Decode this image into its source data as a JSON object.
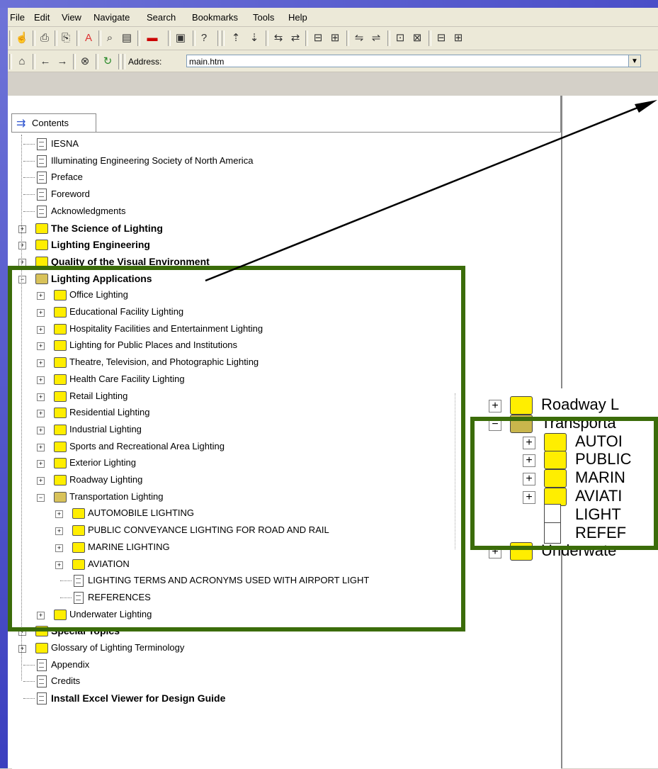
{
  "menu": [
    "File",
    "Edit",
    "View",
    "Navigate",
    "Search",
    "Bookmarks",
    "Tools",
    "Help"
  ],
  "address": {
    "label": "Address:",
    "value": "main.htm"
  },
  "tab": {
    "label": "Contents"
  },
  "tree": [
    {
      "label": "IESNA",
      "type": "page",
      "bold": false
    },
    {
      "label": "Illuminating Engineering Society of North America",
      "type": "page",
      "bold": false
    },
    {
      "label": "Preface",
      "type": "page",
      "bold": false
    },
    {
      "label": "Foreword",
      "type": "page",
      "bold": false
    },
    {
      "label": "Acknowledgments",
      "type": "page",
      "bold": false
    },
    {
      "label": "The Science of Lighting",
      "type": "folder",
      "bold": true
    },
    {
      "label": "Lighting Engineering",
      "type": "folder",
      "bold": true
    },
    {
      "label": "Quality of the Visual Environment",
      "type": "folder",
      "bold": true
    },
    {
      "label": "Lighting Applications",
      "type": "open",
      "bold": true
    },
    {
      "label": "Office Lighting",
      "type": "folder",
      "bold": false
    },
    {
      "label": "Educational Facility Lighting",
      "type": "folder",
      "bold": false
    },
    {
      "label": "Hospitality Facilities and Entertainment Lighting",
      "type": "folder",
      "bold": false
    },
    {
      "label": "Lighting for Public Places and Institutions",
      "type": "folder",
      "bold": false
    },
    {
      "label": "Theatre, Television, and Photographic Lighting",
      "type": "folder",
      "bold": false
    },
    {
      "label": "Health Care Facility Lighting",
      "type": "folder",
      "bold": false
    },
    {
      "label": "Retail Lighting",
      "type": "folder",
      "bold": false
    },
    {
      "label": "Residential Lighting",
      "type": "folder",
      "bold": false
    },
    {
      "label": "Industrial Lighting",
      "type": "folder",
      "bold": false
    },
    {
      "label": "Sports and Recreational Area Lighting",
      "type": "folder",
      "bold": false
    },
    {
      "label": "Exterior Lighting",
      "type": "folder",
      "bold": false
    },
    {
      "label": "Roadway Lighting",
      "type": "folder",
      "bold": false
    },
    {
      "label": "Transportation Lighting",
      "type": "open",
      "bold": false
    },
    {
      "label": "AUTOMOBILE LIGHTING",
      "type": "folder",
      "bold": false
    },
    {
      "label": "PUBLIC CONVEYANCE LIGHTING FOR ROAD AND RAIL",
      "type": "folder",
      "bold": false
    },
    {
      "label": "MARINE LIGHTING",
      "type": "folder",
      "bold": false
    },
    {
      "label": "AVIATION",
      "type": "folder",
      "bold": false
    },
    {
      "label": "LIGHTING TERMS AND   ACRONYMS USED WITH AIRPORT LIGHT",
      "type": "page",
      "bold": false
    },
    {
      "label": "REFERENCES",
      "type": "page",
      "bold": false
    },
    {
      "label": "Underwater Lighting",
      "type": "folder",
      "bold": false
    },
    {
      "label": "Special Topics",
      "type": "folder",
      "bold": true
    },
    {
      "label": "Glossary of Lighting Terminology",
      "type": "folder",
      "bold": false
    },
    {
      "label": "Appendix",
      "type": "page",
      "bold": false
    },
    {
      "label": "Credits",
      "type": "page",
      "bold": false
    },
    {
      "label": "Install Excel Viewer for Design Guide",
      "type": "page",
      "bold": true
    }
  ],
  "zoom": [
    {
      "label": "Roadway L",
      "type": "folder"
    },
    {
      "label": "Transporta",
      "type": "open"
    },
    {
      "label": "AUTOI",
      "type": "folder"
    },
    {
      "label": "PUBLIC",
      "type": "folder"
    },
    {
      "label": "MARIN",
      "type": "folder"
    },
    {
      "label": "AVIATI",
      "type": "folder"
    },
    {
      "label": "LIGHT",
      "type": "page"
    },
    {
      "label": "REFEF",
      "type": "page"
    },
    {
      "label": "Underwate",
      "type": "folder"
    }
  ],
  "colors": {
    "highlight_box": "#3b6c0a",
    "folder": "#ffee00",
    "background": "#4a4ec8"
  },
  "icons": [
    "tb-home-icon",
    "tb-back-icon",
    "tb-forward-icon",
    "tb-stop-icon",
    "tb-refresh-icon"
  ]
}
